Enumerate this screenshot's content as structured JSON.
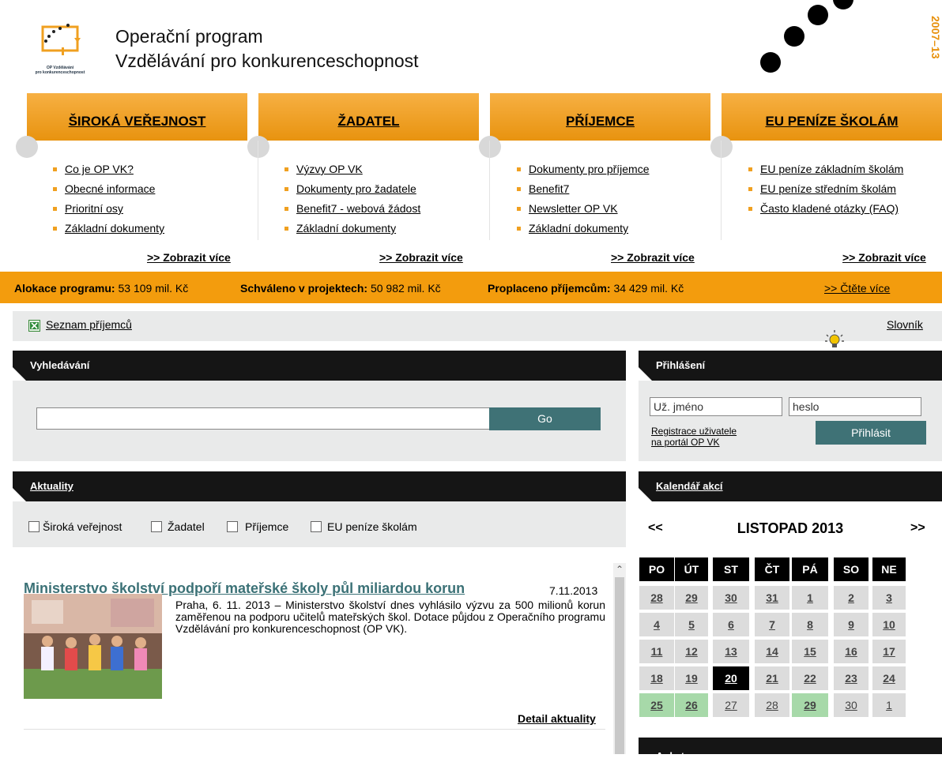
{
  "header": {
    "logo_text_1": "OP Vzdělávání",
    "logo_text_2": "pro konkurenceschopnost",
    "title_line1": "Operační program",
    "title_line2": "Vzdělávání pro konkurenceschopnost",
    "years": "2007–13"
  },
  "nav": {
    "tabs": [
      {
        "label": "ŠIROKÁ VEŘEJNOST",
        "items": [
          "Co je OP VK?",
          "Obecné informace",
          "Prioritní osy",
          "Základní dokumenty"
        ],
        "more": ">> Zobrazit více"
      },
      {
        "label": "ŽADATEL",
        "items": [
          "Výzvy OP VK",
          "Dokumenty pro žadatele",
          "Benefit7 - webová žádost",
          "Základní dokumenty"
        ],
        "more": ">> Zobrazit více"
      },
      {
        "label": "PŘÍJEMCE",
        "items": [
          "Dokumenty pro příjemce",
          "Benefit7",
          "Newsletter OP VK",
          "Základní dokumenty"
        ],
        "more": ">> Zobrazit více"
      },
      {
        "label": "EU PENÍZE ŠKOLÁM",
        "items": [
          "EU peníze základním školám",
          "EU peníze středním školám",
          "Často kladené otázky (FAQ)"
        ],
        "more": ">> Zobrazit více"
      }
    ]
  },
  "alloc": {
    "alloc_label": "Alokace programu:",
    "alloc_value": "53 109 mil. Kč",
    "approved_label": "Schváleno v projektech:",
    "approved_value": "50 982 mil. Kč",
    "paid_label": "Proplaceno příjemcům:",
    "paid_value": "34 429 mil. Kč",
    "read_more": ">> Čtěte více"
  },
  "listbar": {
    "recipients_link": "Seznam příjemců",
    "glossary_link": "Slovník"
  },
  "search": {
    "title": "Vyhledávání",
    "value": "",
    "go_label": "Go"
  },
  "login": {
    "title": "Přihlášení",
    "username_value": "Už. jméno",
    "password_value": "heslo",
    "register_line1": "Registrace uživatele",
    "register_line2": "na portál OP VK",
    "submit_label": "Přihlásit"
  },
  "news": {
    "title": "Aktuality",
    "filters": [
      "Široká veřejnost",
      "Žadatel",
      "Příjemce",
      "EU peníze školám"
    ],
    "article": {
      "headline": "Ministerstvo školství podpoří mateřské školy půl miliardou korun",
      "date": "7.11.2013",
      "text": "Praha, 6. 11. 2013 – Ministerstvo školství dnes vyhlásilo výzvu za 500 milionů korun zaměřenou na podporu učitelů mateřských škol. Dotace půjdou z Operačního programu Vzdělávání pro konkurenceschopnost (OP VK).",
      "detail_link": "Detail aktuality"
    }
  },
  "calendar": {
    "title": "Kalendář akcí",
    "prev": "<<",
    "next": ">>",
    "month": "LISTOPAD 2013",
    "weekdays": [
      "PO",
      "ÚT",
      "ST",
      "ČT",
      "PÁ",
      "SO",
      "NE"
    ],
    "weeks": [
      [
        "28",
        "29",
        "30",
        "31",
        "1",
        "2",
        "3"
      ],
      [
        "4",
        "5",
        "6",
        "7",
        "8",
        "9",
        "10"
      ],
      [
        "11",
        "12",
        "13",
        "14",
        "15",
        "16",
        "17"
      ],
      [
        "18",
        "19",
        "20",
        "21",
        "22",
        "23",
        "24"
      ],
      [
        "25",
        "26",
        "27",
        "28",
        "29",
        "30",
        "1"
      ]
    ]
  },
  "poll": {
    "title": "Anketa"
  },
  "colors": {
    "orange": "#f39c0d",
    "teal": "#3f7276",
    "calendar_green": "#a7d9a9"
  }
}
